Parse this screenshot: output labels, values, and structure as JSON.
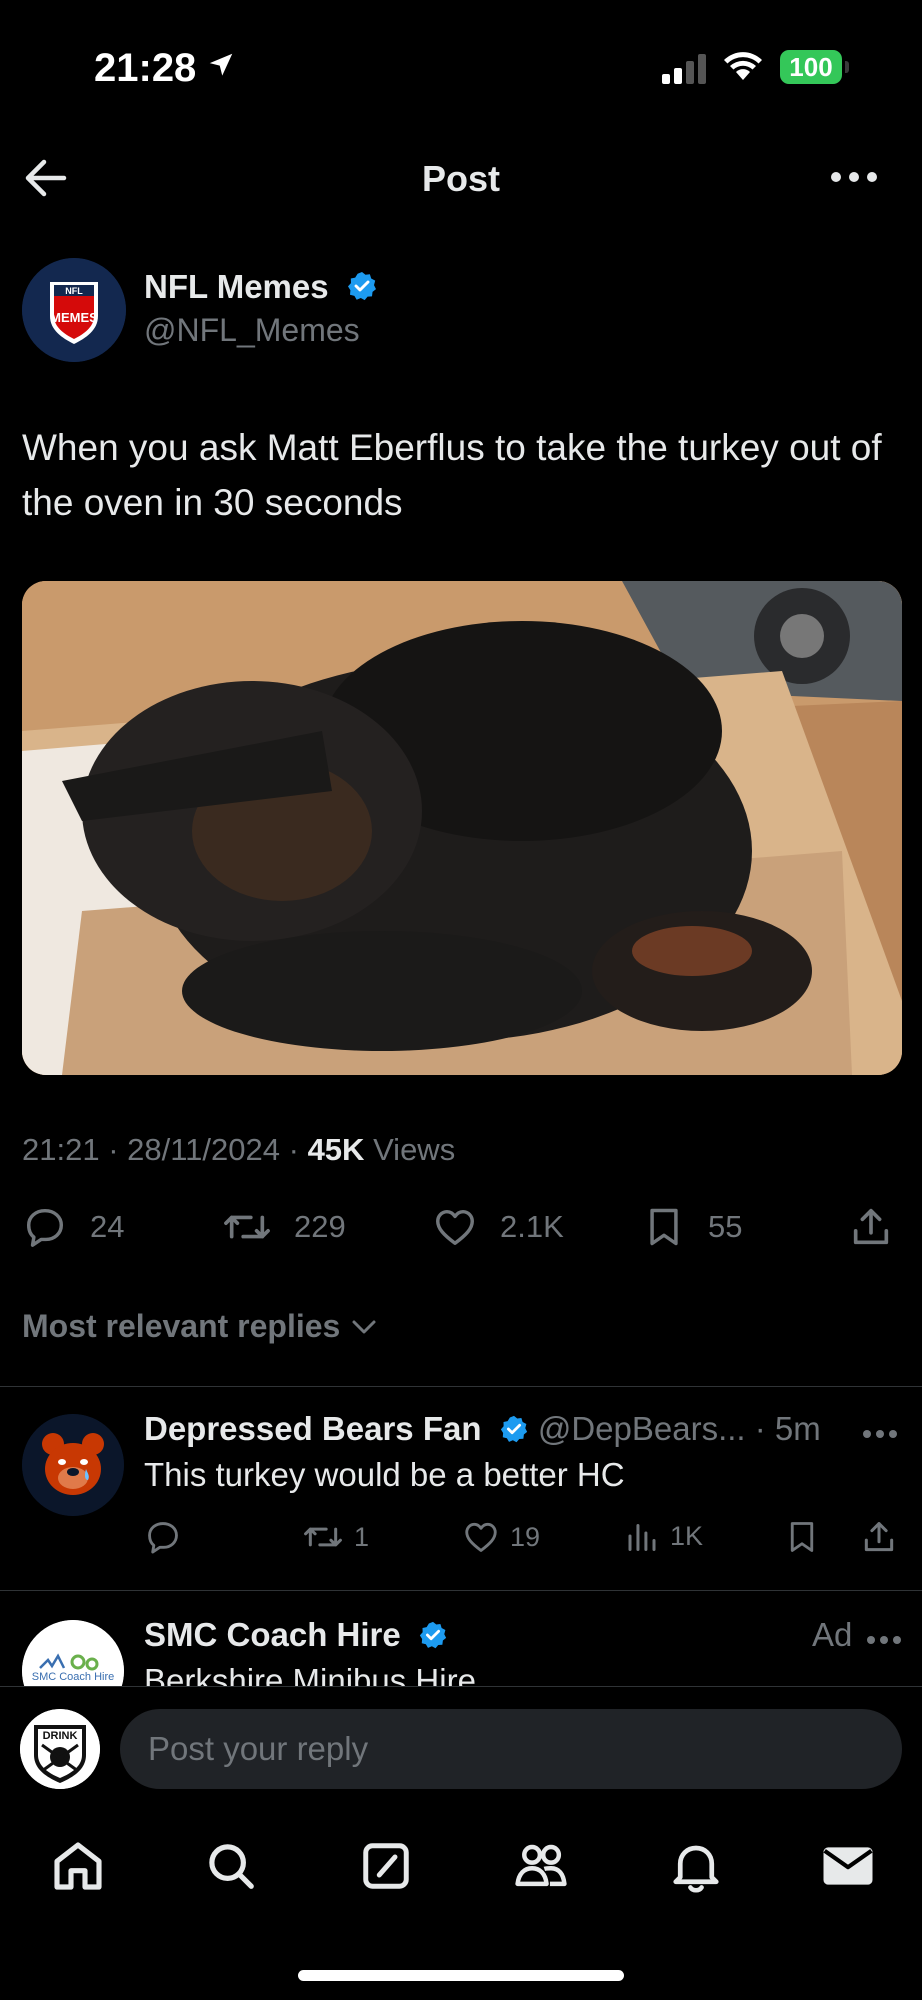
{
  "status": {
    "time": "21:28",
    "battery": "100"
  },
  "header": {
    "title": "Post"
  },
  "post": {
    "author_name": "NFL Memes",
    "author_handle": "@NFL_Memes",
    "text": "When you ask Matt Eberflus to take the turkey out of the oven in 30 seconds",
    "time": "21:21",
    "date": "28/11/2024",
    "views_count": "45K",
    "views_label": "Views",
    "replies": "24",
    "reposts": "229",
    "likes": "2.1K",
    "bookmarks": "55"
  },
  "replies_filter": "Most relevant replies",
  "reply": {
    "name": "Depressed Bears Fan",
    "handle": "@DepBears...",
    "age": "5m",
    "text": "This turkey would be a better HC",
    "reposts": "1",
    "likes": "19",
    "views": "1K"
  },
  "ad": {
    "name": "SMC Coach Hire",
    "label": "Ad",
    "subtitle": "Berkshire Minibus Hire",
    "logo_text": "SMC Coach Hire"
  },
  "compose": {
    "placeholder": "Post your reply",
    "avatar_text": "DRINK"
  },
  "colors": {
    "accent": "#1d9bf0",
    "background": "#000000",
    "muted": "#71767b",
    "text": "#e7e9ea",
    "battery": "#34c759"
  },
  "icons": [
    "location-arrow-icon",
    "signal-icon",
    "wifi-icon",
    "back-arrow-icon",
    "more-icon",
    "verified-icon",
    "reply-icon",
    "repost-icon",
    "like-icon",
    "bookmark-icon",
    "share-icon",
    "views-icon",
    "chevron-down-icon",
    "home-icon",
    "search-icon",
    "compose-icon",
    "communities-icon",
    "notifications-icon",
    "messages-icon"
  ]
}
